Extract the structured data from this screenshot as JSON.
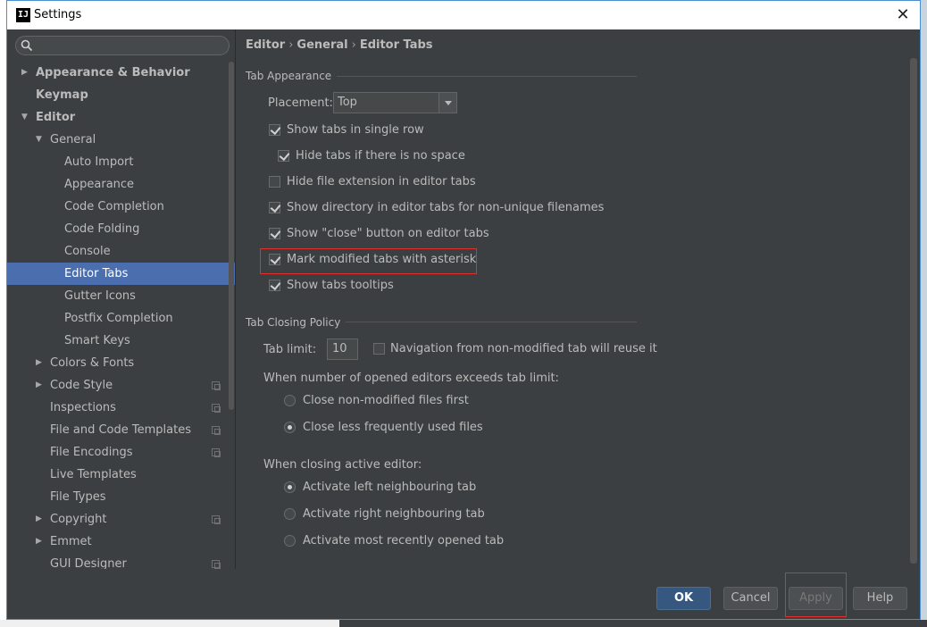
{
  "window": {
    "title": "Settings"
  },
  "sidebar": {
    "search_placeholder": "",
    "items": [
      {
        "label": "Appearance & Behavior",
        "level": 0,
        "arrow": "right",
        "bold": true
      },
      {
        "label": "Keymap",
        "level": 0,
        "arrow": "",
        "bold": true
      },
      {
        "label": "Editor",
        "level": 0,
        "arrow": "down",
        "bold": true
      },
      {
        "label": "General",
        "level": 1,
        "arrow": "down"
      },
      {
        "label": "Auto Import",
        "level": 2,
        "arrow": ""
      },
      {
        "label": "Appearance",
        "level": 2,
        "arrow": ""
      },
      {
        "label": "Code Completion",
        "level": 2,
        "arrow": ""
      },
      {
        "label": "Code Folding",
        "level": 2,
        "arrow": ""
      },
      {
        "label": "Console",
        "level": 2,
        "arrow": ""
      },
      {
        "label": "Editor Tabs",
        "level": 2,
        "arrow": "",
        "selected": true
      },
      {
        "label": "Gutter Icons",
        "level": 2,
        "arrow": ""
      },
      {
        "label": "Postfix Completion",
        "level": 2,
        "arrow": ""
      },
      {
        "label": "Smart Keys",
        "level": 2,
        "arrow": ""
      },
      {
        "label": "Colors & Fonts",
        "level": 1,
        "arrow": "right"
      },
      {
        "label": "Code Style",
        "level": 1,
        "arrow": "right",
        "project": true
      },
      {
        "label": "Inspections",
        "level": 1,
        "arrow": "",
        "project": true
      },
      {
        "label": "File and Code Templates",
        "level": 1,
        "arrow": "",
        "project": true
      },
      {
        "label": "File Encodings",
        "level": 1,
        "arrow": "",
        "project": true
      },
      {
        "label": "Live Templates",
        "level": 1,
        "arrow": ""
      },
      {
        "label": "File Types",
        "level": 1,
        "arrow": ""
      },
      {
        "label": "Copyright",
        "level": 1,
        "arrow": "right",
        "project": true
      },
      {
        "label": "Emmet",
        "level": 1,
        "arrow": "right"
      },
      {
        "label": "GUI Designer",
        "level": 1,
        "arrow": "",
        "project": true
      }
    ]
  },
  "breadcrumb": {
    "part1": "Editor",
    "part2": "General",
    "part3": "Editor Tabs",
    "sep": "›"
  },
  "tab_appearance": {
    "title": "Tab Appearance",
    "placement_label": "Placement:",
    "placement_value": "Top",
    "show_single_row": {
      "label": "Show tabs in single row",
      "checked": true
    },
    "hide_no_space": {
      "label": "Hide tabs if there is no space",
      "checked": true
    },
    "hide_extension": {
      "label": "Hide file extension in editor tabs",
      "checked": false
    },
    "show_directory": {
      "label": "Show directory in editor tabs for non-unique filenames",
      "checked": true
    },
    "show_close": {
      "label": "Show \"close\" button on editor tabs",
      "checked": true
    },
    "mark_modified": {
      "label": "Mark modified tabs with asterisk",
      "checked": true
    },
    "show_tooltips": {
      "label": "Show tabs tooltips",
      "checked": true
    }
  },
  "tab_closing": {
    "title": "Tab Closing Policy",
    "tab_limit_label": "Tab limit:",
    "tab_limit_value": "10",
    "nav_reuse": {
      "label": "Navigation from non-modified tab will reuse it",
      "checked": false
    },
    "exceeds_label": "When number of opened editors exceeds tab limit:",
    "close_non_modified": {
      "label": "Close non-modified files first",
      "selected": false
    },
    "close_less_frequent": {
      "label": "Close less frequently used files",
      "selected": true
    },
    "closing_active_label": "When closing active editor:",
    "activate_left": {
      "label": "Activate left neighbouring tab",
      "selected": true
    },
    "activate_right": {
      "label": "Activate right neighbouring tab",
      "selected": false
    },
    "activate_recent": {
      "label": "Activate most recently opened tab",
      "selected": false
    }
  },
  "footer": {
    "ok": "OK",
    "cancel": "Cancel",
    "apply": "Apply",
    "help": "Help"
  },
  "colors": {
    "selection": "#4b6eaf",
    "highlight": "#e0302b",
    "primary_button": "#365880"
  }
}
